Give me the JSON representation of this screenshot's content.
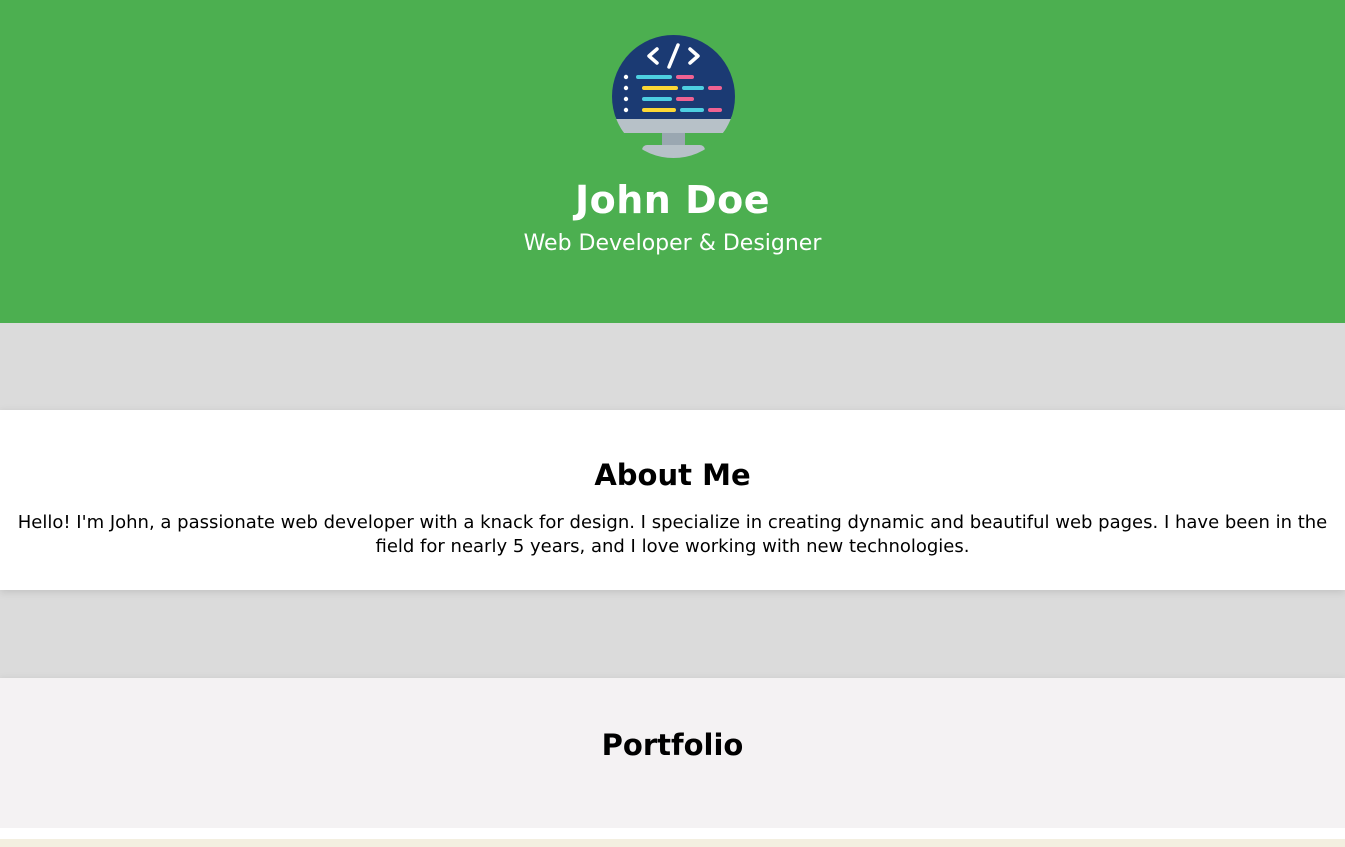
{
  "header": {
    "name": "John Doe",
    "subtitle": "Web Developer & Designer",
    "avatar_icon": "code-monitor-icon"
  },
  "about": {
    "title": "About Me",
    "text": "Hello! I'm John, a passionate web developer with a knack for design. I specialize in creating dynamic and beautiful web pages. I have been in the field for nearly 5 years, and I love working with new technologies."
  },
  "portfolio": {
    "title": "Portfolio"
  },
  "colors": {
    "header_bg": "#4caf50",
    "page_bg": "#dbdbdb",
    "portfolio_bg": "#f4f2f3",
    "monitor_screen": "#1b3a73"
  }
}
